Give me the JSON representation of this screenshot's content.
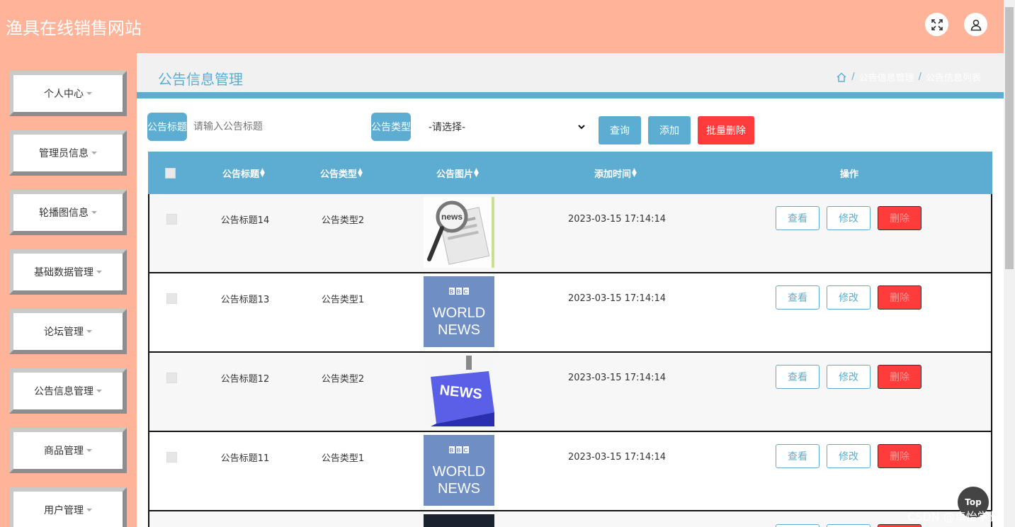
{
  "header": {
    "brand": "渔具在线销售网站",
    "icons": [
      "expand-icon",
      "user-icon"
    ]
  },
  "sidebar": {
    "items": [
      {
        "label": "个人中心"
      },
      {
        "label": "管理员信息"
      },
      {
        "label": "轮播图信息"
      },
      {
        "label": "基础数据管理"
      },
      {
        "label": "论坛管理"
      },
      {
        "label": "公告信息管理"
      },
      {
        "label": "商品管理"
      },
      {
        "label": "用户管理"
      }
    ]
  },
  "page": {
    "title": "公告信息管理",
    "breadcrumb": [
      "公告信息管理",
      "公告信息列表"
    ]
  },
  "search": {
    "title_label": "公告标题",
    "title_placeholder": "请输入公告标题",
    "type_label": "公告类型",
    "type_selected": "-请选择-",
    "query_button": "查询",
    "add_button": "添加",
    "batch_delete_button": "批量删除"
  },
  "table": {
    "columns": [
      "公告标题",
      "公告类型",
      "公告图片",
      "添加时间",
      "操作"
    ],
    "actions": {
      "view": "查看",
      "edit": "修改",
      "delete": "删除"
    },
    "rows": [
      {
        "title": "公告标题14",
        "type": "公告类型2",
        "image": "news-magnifier",
        "time": "2023-03-15 17:14:14"
      },
      {
        "title": "公告标题13",
        "type": "公告类型1",
        "image": "bbc-world-news",
        "time": "2023-03-15 17:14:14"
      },
      {
        "title": "公告标题12",
        "type": "公告类型2",
        "image": "news-key",
        "time": "2023-03-15 17:14:14"
      },
      {
        "title": "公告标题11",
        "type": "公告类型1",
        "image": "bbc-world-news",
        "time": "2023-03-15 17:14:14"
      }
    ]
  },
  "footer": {
    "top_button": "Top",
    "watermark": "CSDN @卓怡学长"
  },
  "colors": {
    "header_bg": "#ffb398",
    "accent": "#5dadd2",
    "danger": "#ff3c3c"
  }
}
